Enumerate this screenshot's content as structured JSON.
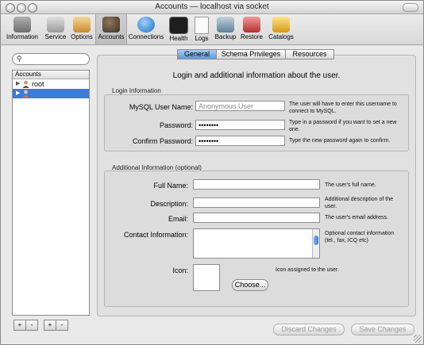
{
  "window": {
    "title": "Accounts — localhost via socket"
  },
  "toolbar": {
    "items": [
      {
        "label": "Information",
        "color": "#7a7a7a"
      },
      {
        "label": "Service",
        "color": "#9a9a9a"
      },
      {
        "label": "Options",
        "color": "#d8a040"
      },
      {
        "label": "Accounts",
        "color": "#5a4a3a"
      },
      {
        "label": "Connections",
        "color": "#3b8fd6"
      },
      {
        "label": "Health",
        "color": "#2b2b2b"
      },
      {
        "label": "Logs",
        "color": "#f0f0f0"
      },
      {
        "label": "Backup",
        "color": "#6f8fa6"
      },
      {
        "label": "Restore",
        "color": "#c73d3d"
      },
      {
        "label": "Catalogs",
        "color": "#e4b42a"
      }
    ]
  },
  "search": {
    "icon": "magnifier-icon",
    "value": ""
  },
  "accounts": {
    "header": "Accounts",
    "rows": [
      {
        "name": "root"
      },
      {
        "name": ""
      }
    ]
  },
  "tabs": [
    {
      "label": "General"
    },
    {
      "label": "Schema Privileges"
    },
    {
      "label": "Resources"
    }
  ],
  "general": {
    "heading": "Login and additional information about the user.",
    "login": {
      "group_label": "Login Information",
      "username_label": "MySQL User Name:",
      "username_placeholder": "Anonymous User",
      "username_help": "The user will have to enter this username to connect to MySQL.",
      "password_label": "Password:",
      "password_value": "••••••••",
      "password_help": "Type in a password if you want to set a new one.",
      "confirm_label": "Confirm Password:",
      "confirm_value": "••••••••",
      "confirm_help": "Type the new password again to confirm."
    },
    "additional": {
      "group_label": "Additional Information (optional)",
      "fullname_label": "Full Name:",
      "fullname_help": "The user's full name.",
      "description_label": "Description:",
      "description_help": "Additional description of the user.",
      "email_label": "Email:",
      "email_help": "The user's email address.",
      "contact_label": "Contact Information:",
      "contact_help": "Optional contact information (tel., fax, ICQ etc)",
      "icon_label": "Icon:",
      "icon_help": "Icon assigned to the user.",
      "choose_label": "Choose..."
    }
  },
  "footer": {
    "discard_label": "Discard Changes",
    "save_label": "Save Changes"
  }
}
